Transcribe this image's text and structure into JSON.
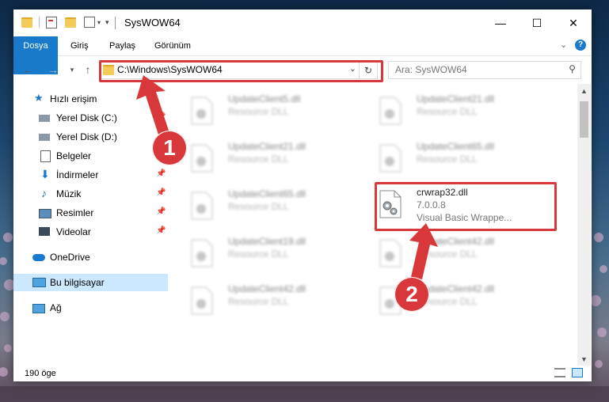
{
  "window": {
    "title": "SysWOW64",
    "controls": {
      "minimize": "—",
      "maximize": "☐",
      "close": "✕"
    }
  },
  "ribbon": {
    "tabs": [
      "Dosya",
      "Giriş",
      "Paylaş",
      "Görünüm"
    ]
  },
  "address": {
    "path": "C:\\Windows\\SysWOW64",
    "search_placeholder": "Ara: SysWOW64"
  },
  "nav": {
    "items": [
      {
        "label": "Hızlı erişim",
        "icon": "star-icon"
      },
      {
        "label": "Yerel Disk (C:)",
        "icon": "drive-icon"
      },
      {
        "label": "Yerel Disk (D:)",
        "icon": "drive-icon"
      },
      {
        "label": "Belgeler",
        "icon": "documents-icon"
      },
      {
        "label": "İndirmeler",
        "icon": "download-icon"
      },
      {
        "label": "Müzik",
        "icon": "music-icon"
      },
      {
        "label": "Resimler",
        "icon": "pictures-icon"
      },
      {
        "label": "Videolar",
        "icon": "video-icon"
      },
      {
        "label": "OneDrive",
        "icon": "cloud-icon"
      },
      {
        "label": "Bu bilgisayar",
        "icon": "computer-icon"
      },
      {
        "label": "Ağ",
        "icon": "network-icon"
      }
    ]
  },
  "files": [
    {
      "name": "UpdateClient5.dll",
      "type": "Resource DLL"
    },
    {
      "name": "UpdateClient21.dll",
      "type": "Resource DLL"
    },
    {
      "name": "UpdateClient21.dll",
      "type": "Resource DLL"
    },
    {
      "name": "UpdateClient65.dll",
      "type": "Resource DLL"
    },
    {
      "name": "UpdateClient65.dll",
      "type": "Resource DLL"
    },
    {
      "name": "crwrap32.dll",
      "version": "7.0.0.8",
      "type": "Visual Basic Wrappe..."
    },
    {
      "name": "UpdateClient19.dll",
      "type": "Resource DLL"
    },
    {
      "name": "UpdateClient42.dll",
      "type": "Resource DLL"
    },
    {
      "name": "UpdateClient42.dll",
      "type": "Resource DLL"
    },
    {
      "name": "UpdateClient42.dll",
      "type": "Resource DLL"
    }
  ],
  "status": {
    "count": "190 öge"
  },
  "callouts": [
    "1",
    "2"
  ],
  "colors": {
    "accent": "#1979ca",
    "highlight": "#d9383a",
    "selection": "#cce8ff"
  }
}
